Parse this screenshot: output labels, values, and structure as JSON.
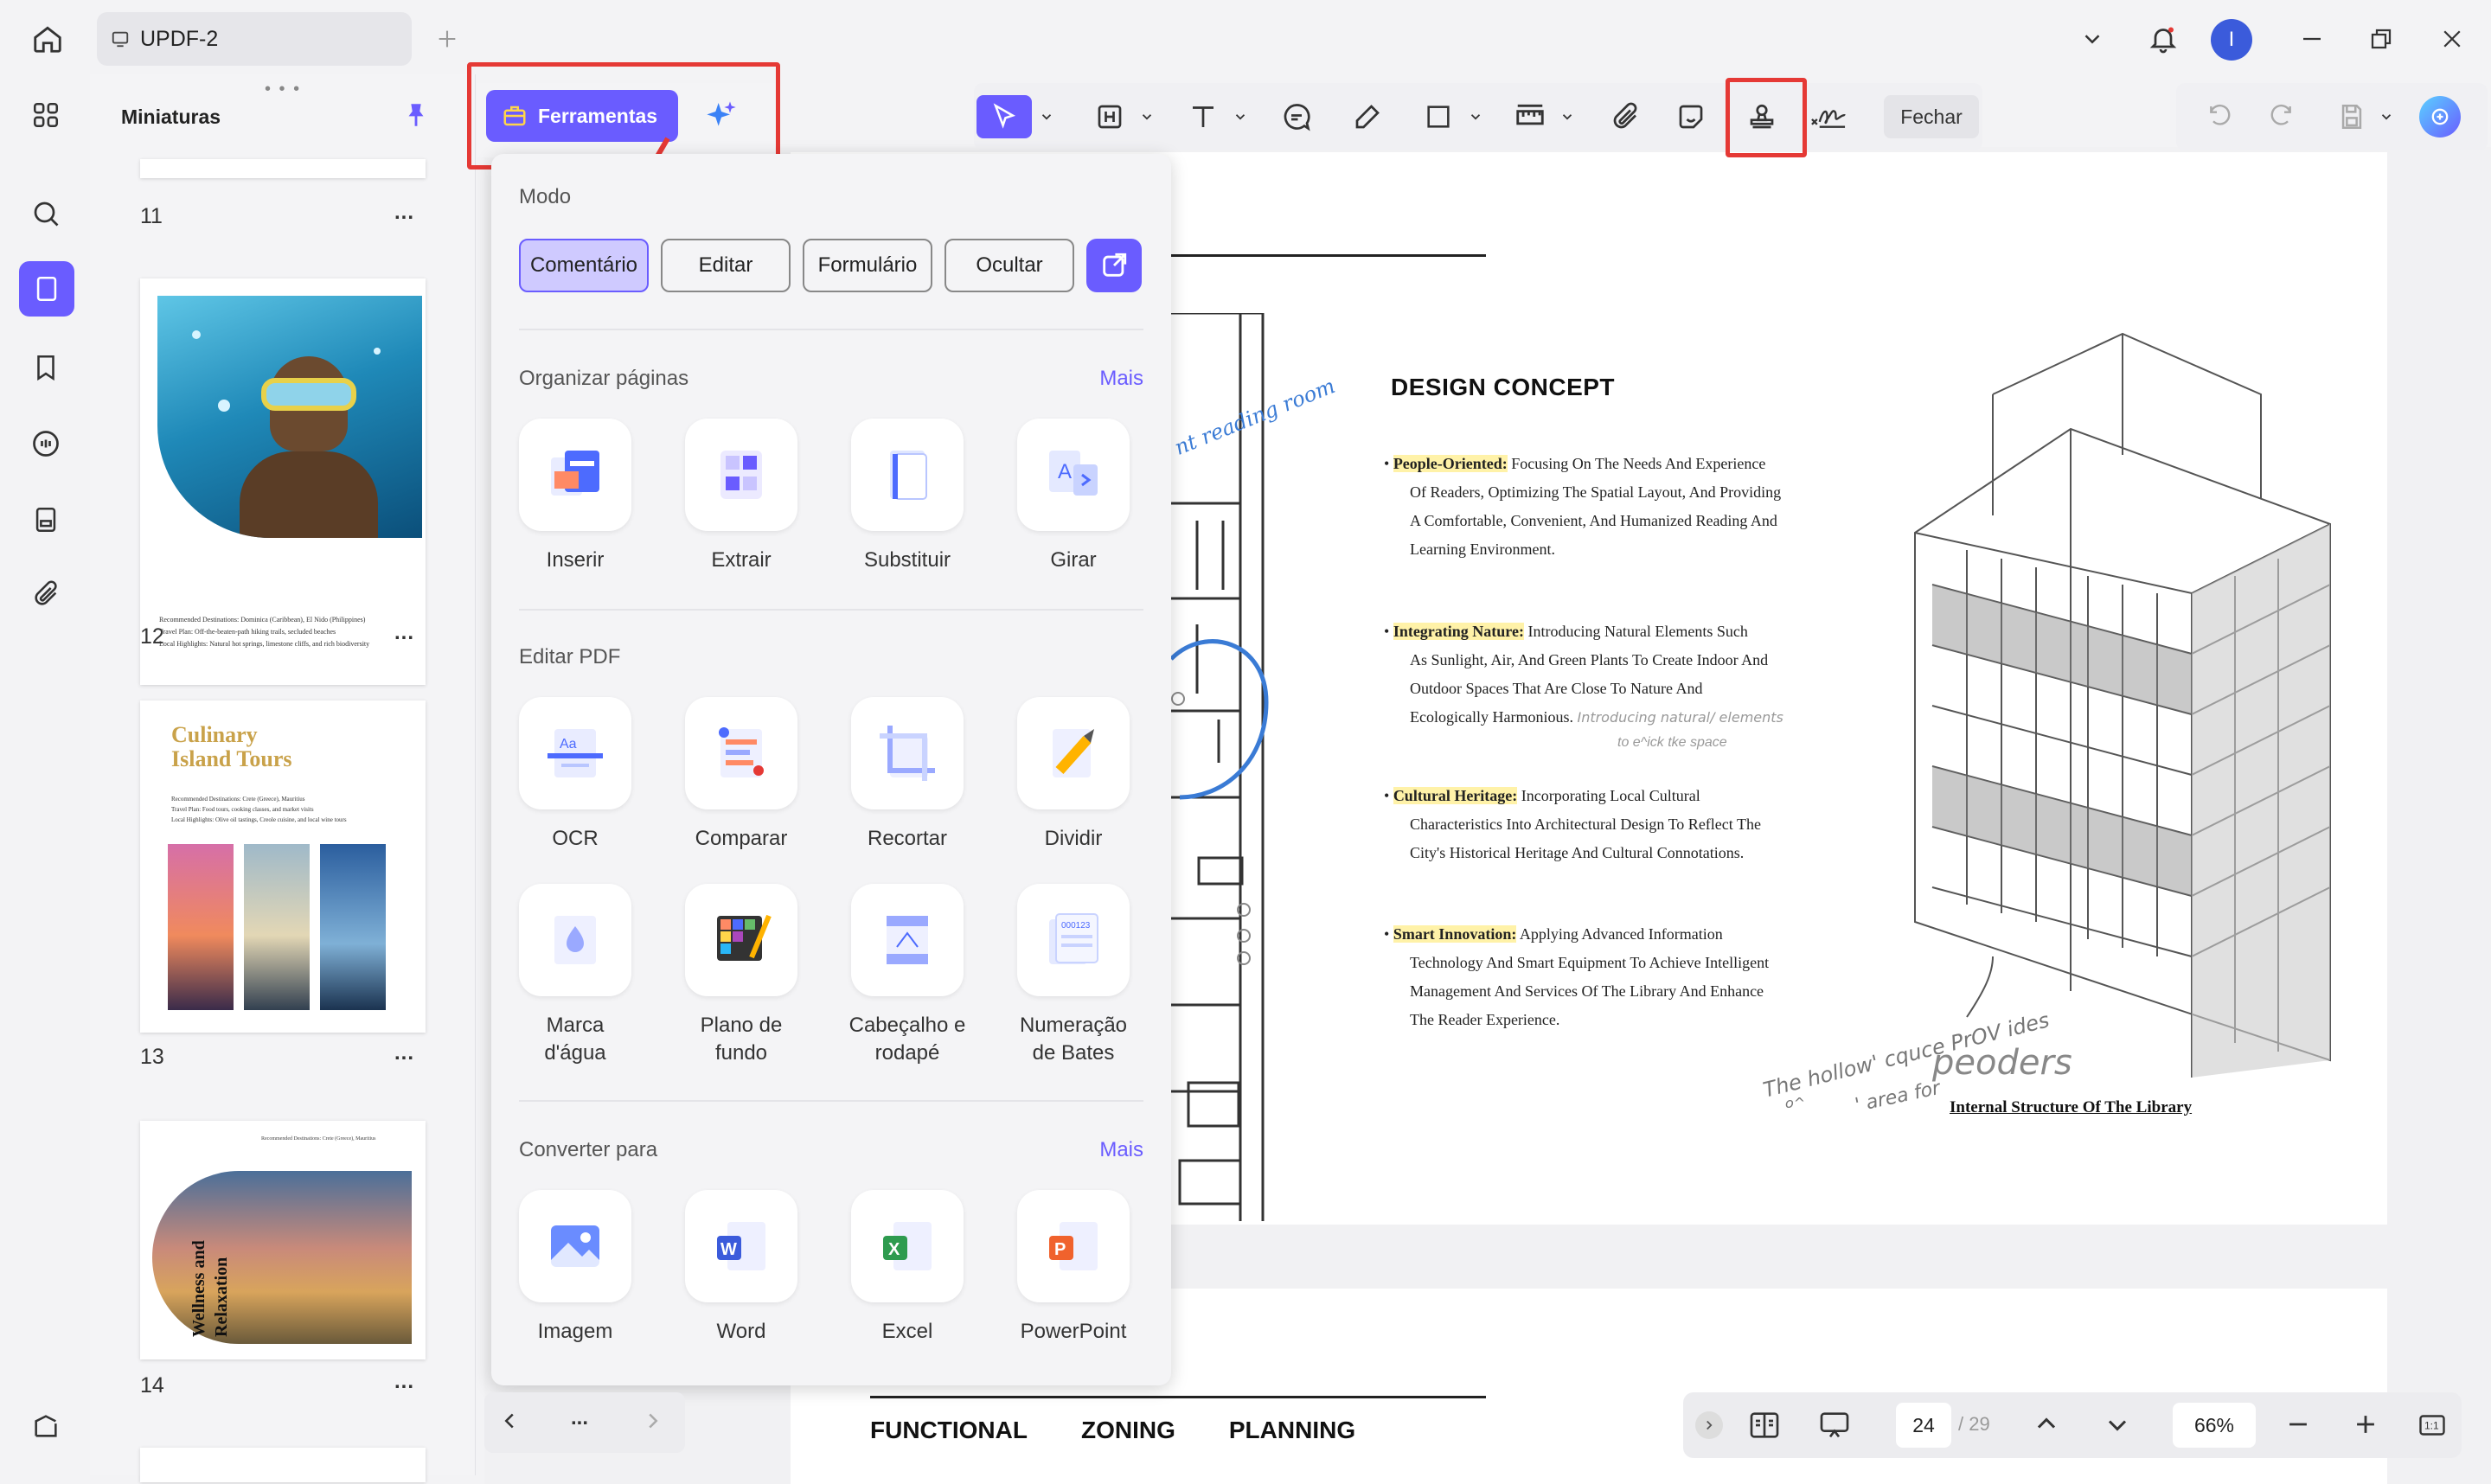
{
  "titlebar": {
    "tab_label": "UPDF-2",
    "avatar_letter": "I"
  },
  "thumbnails": {
    "title": "Miniaturas",
    "pages": [
      {
        "num": "11"
      },
      {
        "num": "12",
        "caption": [
          "Recommended Destinations: Dominica (Caribbean), El Nido (Philippines)",
          "Travel Plan: Off-the-beaten-path hiking trails, secluded beaches",
          "Local Highlights: Natural hot springs, limestone cliffs, and rich biodiversity"
        ]
      },
      {
        "num": "13",
        "title1": "Culinary",
        "title2": "Island Tours",
        "caption": [
          "Recommended Destinations: Crete (Greece), Mauritius",
          "Travel Plan: Food tours, cooking classes, and market visits",
          "Local Highlights: Olive oil tastings, Creole cuisine, and local wine tours"
        ]
      },
      {
        "num": "14",
        "title1": "Wellness and",
        "title2": "Relaxation",
        "caption": "Recommended Destinations: Crete (Greece), Mauritius"
      }
    ],
    "more": "..."
  },
  "toolbar": {
    "fechar": "Fechar"
  },
  "popover": {
    "ferramentas": "Ferramentas",
    "modo": "Modo",
    "modes": [
      "Comentário",
      "Editar",
      "Formulário",
      "Ocultar"
    ],
    "organizar": {
      "title": "Organizar páginas",
      "mais": "Mais",
      "items": [
        "Inserir",
        "Extrair",
        "Substituir",
        "Girar"
      ]
    },
    "editar": {
      "title": "Editar PDF",
      "items": [
        "OCR",
        "Comparar",
        "Recortar",
        "Dividir"
      ],
      "items2": [
        [
          "Marca",
          "d'água"
        ],
        [
          "Plano de",
          "fundo"
        ],
        [
          "Cabeçalho e",
          "rodapé"
        ],
        [
          "Numeração",
          "de Bates"
        ]
      ]
    },
    "converter": {
      "title": "Converter para",
      "mais": "Mais",
      "items": [
        "Imagem",
        "Word",
        "Excel",
        "PowerPoint"
      ]
    }
  },
  "document": {
    "heading": "DESIGN CONCEPT",
    "bullets": [
      {
        "key": "People-Oriented:",
        "text1": " Focusing On The        Needs And Experience",
        "lines": [
          "Of Readers, Optimizing The Spatial Layout, And Providing",
          "A Comfortable, Convenient, And Humanized Reading And",
          "Learning Environment."
        ]
      },
      {
        "key": "Integrating Nature:",
        "text1": " Introducing Natural Elements Such",
        "lines": [
          "As Sunlight, Air, And Green Plants To Create Indoor And",
          "Outdoor Spaces That Are Close To Nature And",
          "Ecologically Harmonious."
        ]
      },
      {
        "key": "Cultural Heritage:",
        "text1": " Incorporating Local Cultural",
        "lines": [
          "Characteristics Into Architectural Design To Reflect The",
          "City's Historical Heritage And Cultural Connotations."
        ]
      },
      {
        "key": "Smart Innovation:",
        "text1": " Applying Advanced Information",
        "lines": [
          "Technology And Smart Equipment To Achieve Intelligent",
          "Management And Services Of The Library And Enhance",
          "The Reader Experience."
        ]
      }
    ],
    "hand_note1": "Introducing natural/ elements",
    "hand_note2": "to e^ick tke space",
    "hand_room": "nt reading room",
    "hand_bottom1": "The hollow' cquce PrOV ides",
    "hand_bottom2": "peoders",
    "hand_bottom3": "' area for",
    "hand_bottom4": "o^",
    "caption": "Internal Structure Of The Library",
    "page2_words": [
      "FUNCTIONAL",
      "ZONING",
      "PLANNING"
    ]
  },
  "navigation": {
    "current_page": "24",
    "total_pages": "/ 29",
    "zoom": "66%",
    "more": "..."
  }
}
